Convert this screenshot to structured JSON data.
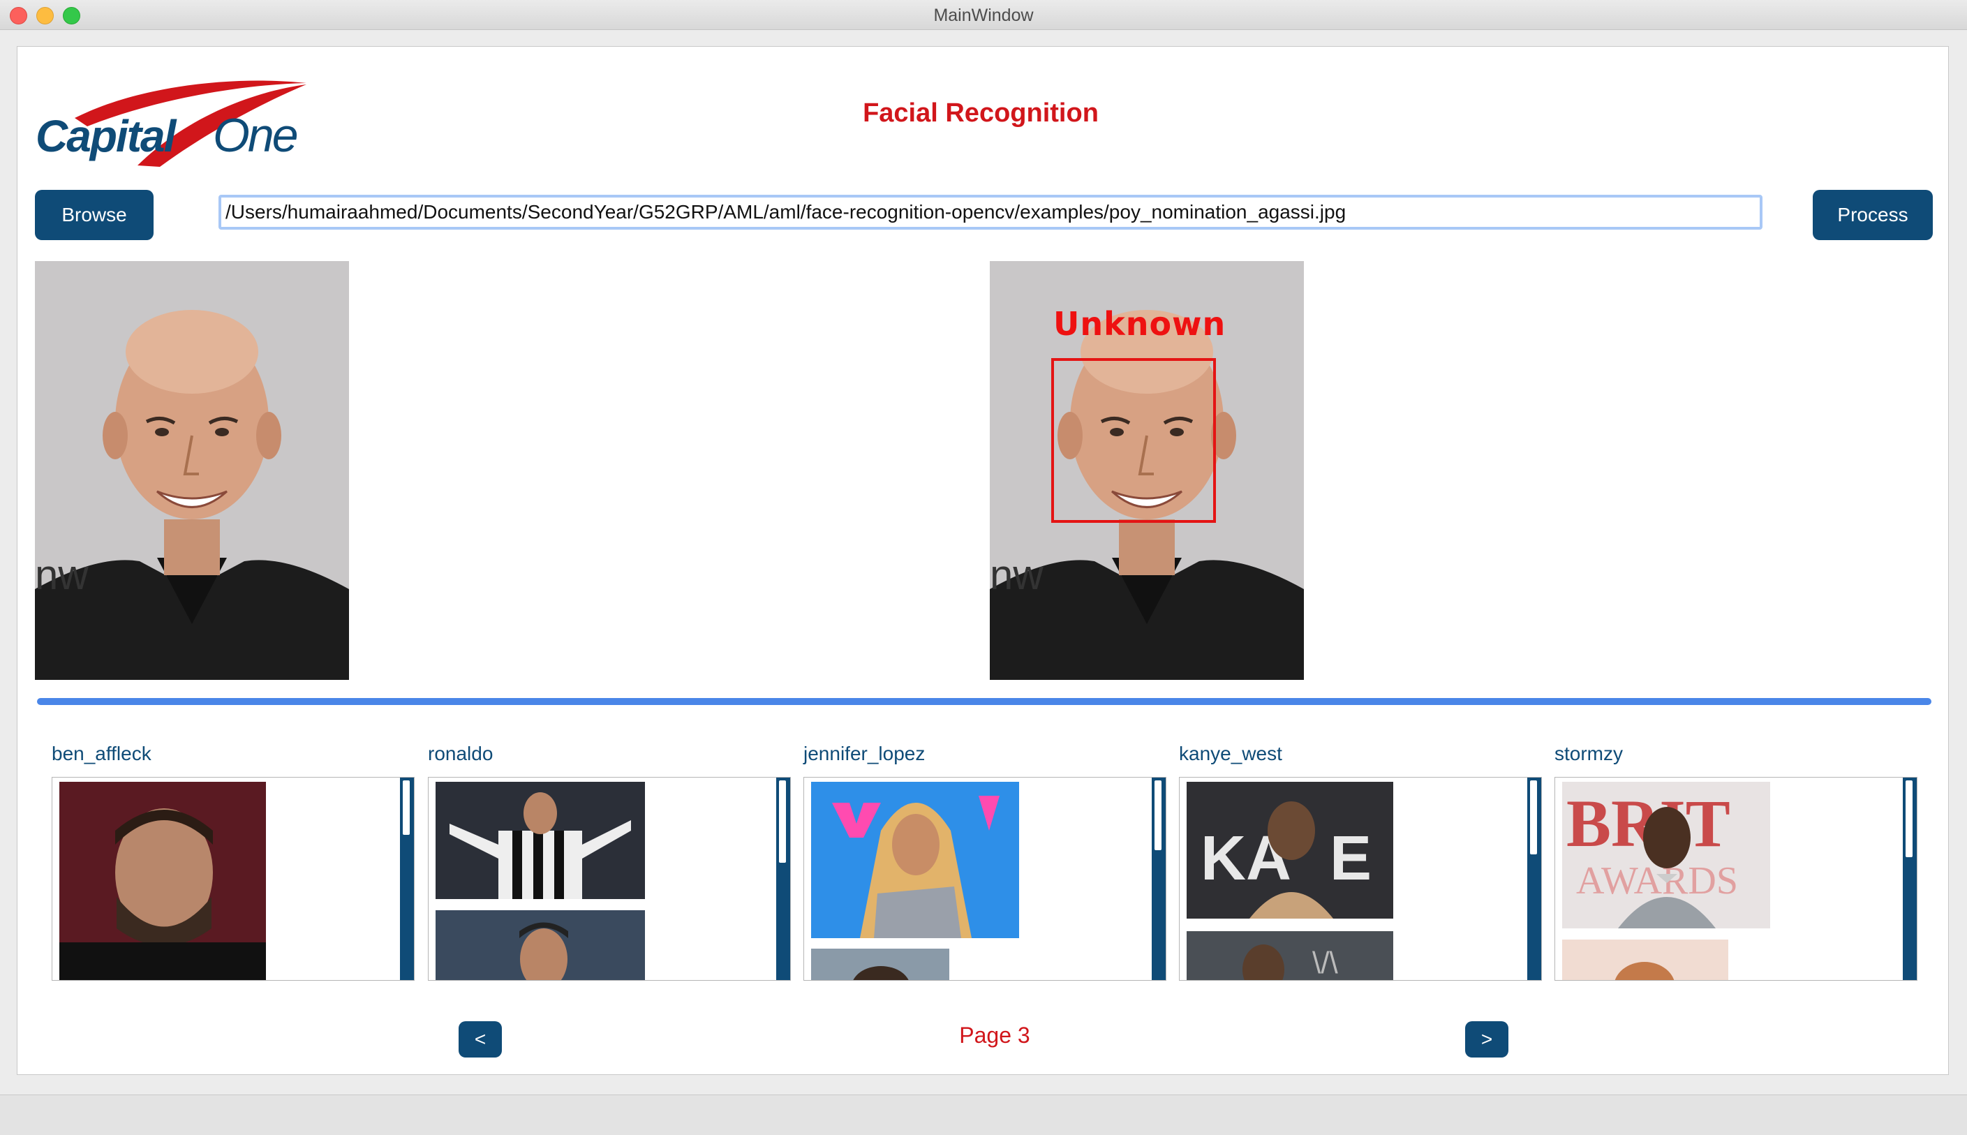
{
  "window": {
    "title": "MainWindow"
  },
  "header": {
    "logo_text": "Capital One",
    "app_title": "Facial Recognition"
  },
  "toolbar": {
    "browse_label": "Browse",
    "path_value": "/Users/humairaahmed/Documents/SecondYear/G52GRP/AML/aml/face-recognition-opencv/examples/poy_nomination_agassi.jpg",
    "process_label": "Process"
  },
  "result": {
    "face_label": "Unknown"
  },
  "gallery": {
    "people": [
      {
        "name": "ben_affleck"
      },
      {
        "name": "ronaldo"
      },
      {
        "name": "jennifer_lopez"
      },
      {
        "name": "kanye_west"
      },
      {
        "name": "stormzy"
      }
    ]
  },
  "pagination": {
    "prev_label": "<",
    "page_label": "Page 3",
    "next_label": ">"
  },
  "colors": {
    "brand_blue": "#0f4b77",
    "brand_red": "#d1161b",
    "progress_blue": "#4a86e8",
    "face_box_red": "#e41414"
  },
  "icons": {
    "close": "close-icon",
    "minimize": "minimize-icon",
    "maximize": "maximize-icon"
  }
}
